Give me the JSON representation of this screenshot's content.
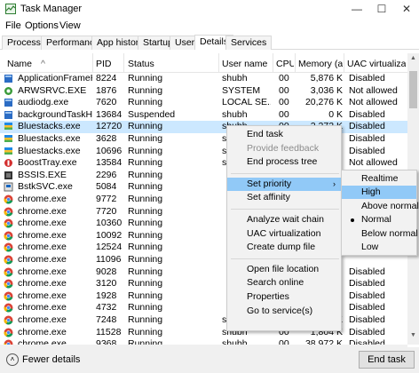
{
  "window": {
    "title": "Task Manager",
    "minimize": "—",
    "maximize": "☐",
    "close": "✕"
  },
  "menu": [
    "File",
    "Options",
    "View"
  ],
  "tabs": [
    "Processes",
    "Performance",
    "App history",
    "Startup",
    "Users",
    "Details",
    "Services"
  ],
  "active_tab": "Details",
  "columns": [
    "Name",
    "PID",
    "Status",
    "User name",
    "CPU",
    "Memory (a...",
    "UAC virtualizat..."
  ],
  "rows": [
    {
      "name": "ApplicationFrameHo...",
      "pid": "8224",
      "status": "Running",
      "user": "shubh",
      "cpu": "00",
      "mem": "5,876 K",
      "uac": "Disabled",
      "icon": "blue"
    },
    {
      "name": "ARWSRVC.EXE",
      "pid": "1876",
      "status": "Running",
      "user": "SYSTEM",
      "cpu": "00",
      "mem": "3,036 K",
      "uac": "Not allowed",
      "icon": "green"
    },
    {
      "name": "audiodg.exe",
      "pid": "7620",
      "status": "Running",
      "user": "LOCAL SE...",
      "cpu": "00",
      "mem": "20,276 K",
      "uac": "Not allowed",
      "icon": "blue"
    },
    {
      "name": "backgroundTaskHos...",
      "pid": "13684",
      "status": "Suspended",
      "user": "shubh",
      "cpu": "00",
      "mem": "0 K",
      "uac": "Disabled",
      "icon": "blue"
    },
    {
      "name": "Bluestacks.exe",
      "pid": "12720",
      "status": "Running",
      "user": "shubh",
      "cpu": "00",
      "mem": "2,272 K",
      "uac": "Disabled",
      "icon": "stack",
      "sel": true
    },
    {
      "name": "Bluestacks.exe",
      "pid": "3628",
      "status": "Running",
      "user": "shubh",
      "cpu": "",
      "mem": "",
      "uac": "Disabled",
      "icon": "stack"
    },
    {
      "name": "Bluestacks.exe",
      "pid": "10696",
      "status": "Running",
      "user": "shubh",
      "cpu": "",
      "mem": "",
      "uac": "Disabled",
      "icon": "stack"
    },
    {
      "name": "BoostTray.exe",
      "pid": "13584",
      "status": "Running",
      "user": "shubh",
      "cpu": "",
      "mem": "",
      "uac": "Not allowed",
      "icon": "red"
    },
    {
      "name": "BSSIS.EXE",
      "pid": "2296",
      "status": "Running",
      "user": "",
      "cpu": "",
      "mem": "",
      "uac": "",
      "icon": "dark"
    },
    {
      "name": "BstkSVC.exe",
      "pid": "5084",
      "status": "Running",
      "user": "",
      "cpu": "",
      "mem": "",
      "uac": "",
      "icon": "box"
    },
    {
      "name": "chrome.exe",
      "pid": "9772",
      "status": "Running",
      "user": "",
      "cpu": "",
      "mem": "",
      "uac": "",
      "icon": "chrome"
    },
    {
      "name": "chrome.exe",
      "pid": "7720",
      "status": "Running",
      "user": "",
      "cpu": "",
      "mem": "",
      "uac": "",
      "icon": "chrome"
    },
    {
      "name": "chrome.exe",
      "pid": "10360",
      "status": "Running",
      "user": "",
      "cpu": "",
      "mem": "",
      "uac": "",
      "icon": "chrome"
    },
    {
      "name": "chrome.exe",
      "pid": "10092",
      "status": "Running",
      "user": "",
      "cpu": "",
      "mem": "",
      "uac": "",
      "icon": "chrome"
    },
    {
      "name": "chrome.exe",
      "pid": "12524",
      "status": "Running",
      "user": "",
      "cpu": "",
      "mem": "",
      "uac": "",
      "icon": "chrome"
    },
    {
      "name": "chrome.exe",
      "pid": "11096",
      "status": "Running",
      "user": "",
      "cpu": "",
      "mem": "",
      "uac": "",
      "icon": "chrome"
    },
    {
      "name": "chrome.exe",
      "pid": "9028",
      "status": "Running",
      "user": "",
      "cpu": "",
      "mem": "",
      "uac": "Disabled",
      "icon": "chrome"
    },
    {
      "name": "chrome.exe",
      "pid": "3120",
      "status": "Running",
      "user": "",
      "cpu": "",
      "mem": "",
      "uac": "Disabled",
      "icon": "chrome"
    },
    {
      "name": "chrome.exe",
      "pid": "1928",
      "status": "Running",
      "user": "",
      "cpu": "",
      "mem": "",
      "uac": "Disabled",
      "icon": "chrome"
    },
    {
      "name": "chrome.exe",
      "pid": "4732",
      "status": "Running",
      "user": "",
      "cpu": "",
      "mem": "",
      "uac": "Disabled",
      "icon": "chrome"
    },
    {
      "name": "chrome.exe",
      "pid": "7248",
      "status": "Running",
      "user": "shubh",
      "cpu": "00",
      "mem": "68,240 K",
      "uac": "Disabled",
      "icon": "chrome"
    },
    {
      "name": "chrome.exe",
      "pid": "11528",
      "status": "Running",
      "user": "shubh",
      "cpu": "00",
      "mem": "1,804 K",
      "uac": "Disabled",
      "icon": "chrome"
    },
    {
      "name": "chrome.exe",
      "pid": "9368",
      "status": "Running",
      "user": "shubh",
      "cpu": "00",
      "mem": "38,972 K",
      "uac": "Disabled",
      "icon": "chrome"
    }
  ],
  "context_menu": [
    {
      "label": "End task"
    },
    {
      "label": "Provide feedback",
      "disabled": true
    },
    {
      "label": "End process tree"
    },
    {
      "sep": true
    },
    {
      "label": "Set priority",
      "submenu": true,
      "highlight": true
    },
    {
      "label": "Set affinity"
    },
    {
      "sep": true
    },
    {
      "label": "Analyze wait chain"
    },
    {
      "label": "UAC virtualization"
    },
    {
      "label": "Create dump file"
    },
    {
      "sep": true
    },
    {
      "label": "Open file location"
    },
    {
      "label": "Search online"
    },
    {
      "label": "Properties"
    },
    {
      "label": "Go to service(s)"
    }
  ],
  "priority_menu": [
    {
      "label": "Realtime"
    },
    {
      "label": "High",
      "highlight": true
    },
    {
      "label": "Above normal"
    },
    {
      "label": "Normal",
      "checked": true
    },
    {
      "label": "Below normal"
    },
    {
      "label": "Low"
    }
  ],
  "footer": {
    "fewer_details": "Fewer details",
    "end_task": "End task"
  },
  "colors": {
    "selection": "#cce8ff",
    "menu_highlight": "#91c9f7"
  }
}
